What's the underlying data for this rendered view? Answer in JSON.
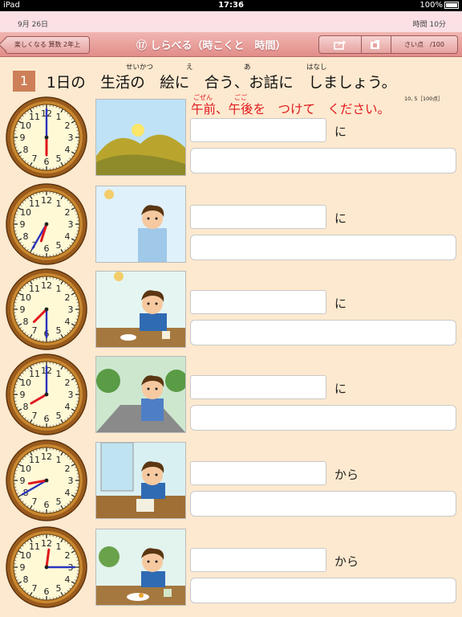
{
  "status": {
    "device": "iPad",
    "time": "17:36",
    "battery": "100%"
  },
  "topinfo": {
    "date": "9月 26日",
    "timer": "時間 10分"
  },
  "nav": {
    "back_label": "楽しくなる 算数 2年上",
    "title": "⑰ しらべる（時こくと　時間）",
    "score_label": "さい点　/100",
    "share_icon": "share-icon",
    "folder_icon": "folder-icon"
  },
  "question": {
    "number": "1",
    "text": "1日の　生活の　絵に　合う、お話に　しましょう。",
    "ruby": [
      {
        "text": "せいかつ"
      },
      {
        "text": "え"
      },
      {
        "text": "あ"
      },
      {
        "text": "はなし"
      }
    ],
    "hint": "午前、午後を　つけて　ください。",
    "hint_ruby": [
      {
        "text": "ごぜん"
      },
      {
        "text": "ごご"
      }
    ],
    "score_note": "10, 5［100点］"
  },
  "rows": [
    {
      "clock": {
        "hour": 6,
        "minute": 0
      },
      "suffix": "に",
      "scene": "sunrise",
      "answer": "",
      "sentence": ""
    },
    {
      "clock": {
        "hour": 6,
        "minute": 35
      },
      "suffix": "に",
      "scene": "brushing teeth",
      "answer": "",
      "sentence": ""
    },
    {
      "clock": {
        "hour": 7,
        "minute": 30
      },
      "suffix": "に",
      "scene": "breakfast",
      "answer": "",
      "sentence": ""
    },
    {
      "clock": {
        "hour": 8,
        "minute": 0
      },
      "suffix": "に",
      "scene": "walking to school",
      "answer": "",
      "sentence": ""
    },
    {
      "clock": {
        "hour": 8,
        "minute": 40
      },
      "suffix": "から",
      "scene": "class",
      "answer": "",
      "sentence": ""
    },
    {
      "clock": {
        "hour": 12,
        "minute": 15
      },
      "suffix": "から",
      "scene": "lunch",
      "answer": "",
      "sentence": ""
    }
  ]
}
